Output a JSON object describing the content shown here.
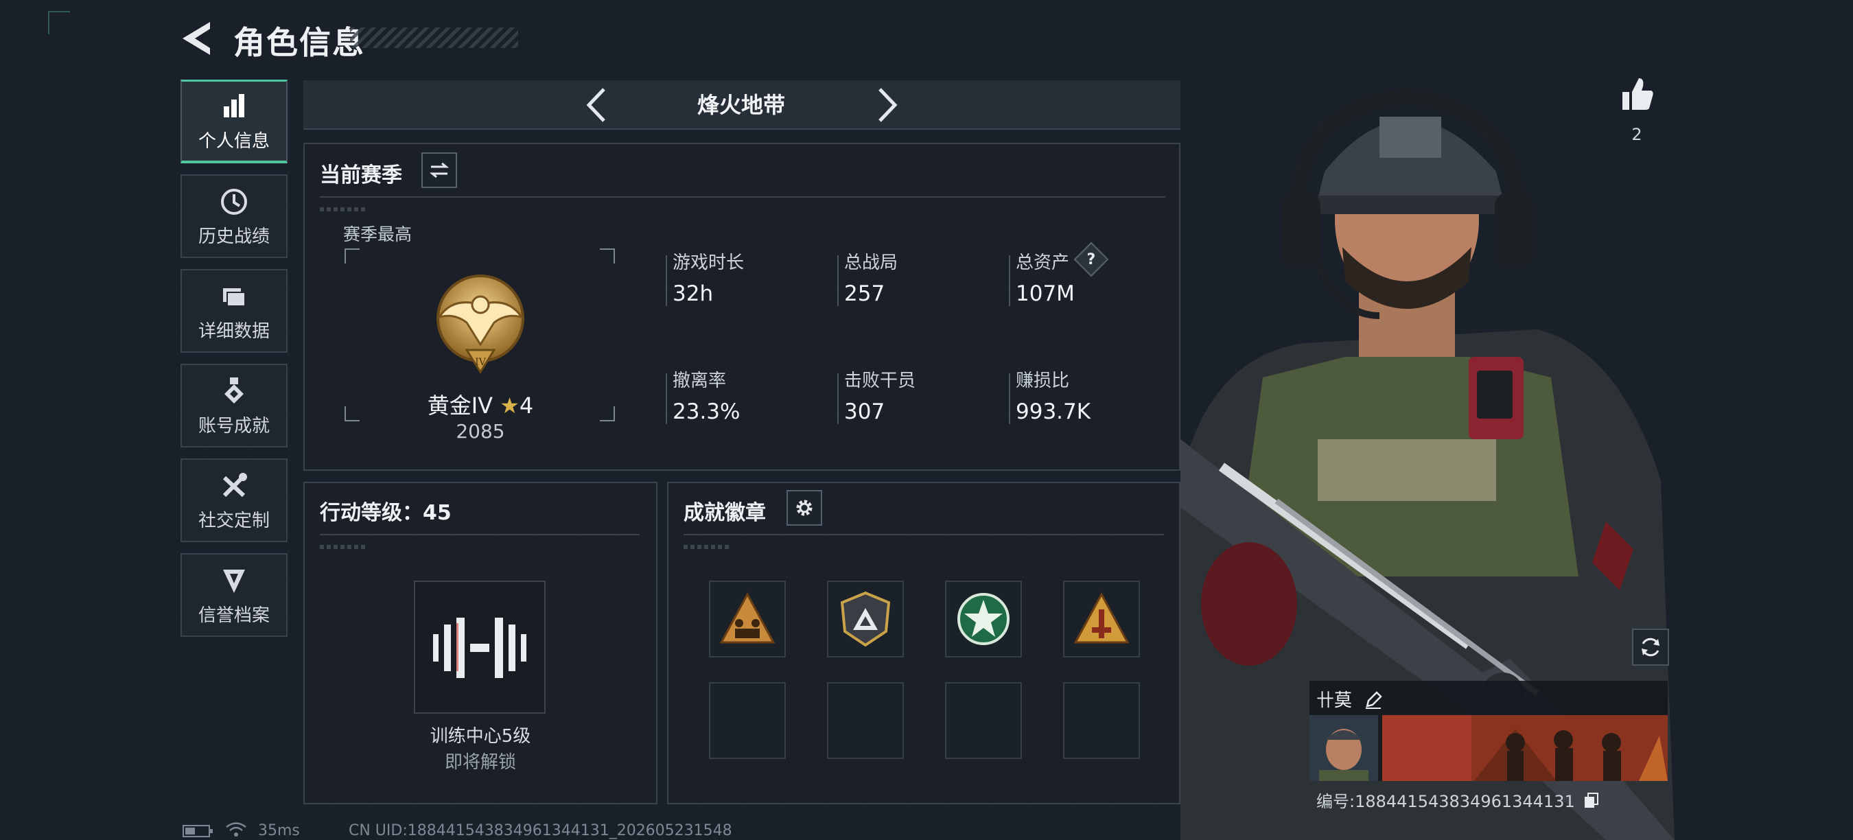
{
  "header": {
    "title": "角色信息"
  },
  "sidebar": {
    "items": [
      {
        "label": "个人信息",
        "icon": "bar-chart-icon",
        "active": true
      },
      {
        "label": "历史战绩",
        "icon": "history-icon"
      },
      {
        "label": "详细数据",
        "icon": "folder-icon"
      },
      {
        "label": "账号成就",
        "icon": "medal-icon"
      },
      {
        "label": "社交定制",
        "icon": "tools-icon"
      },
      {
        "label": "信誉档案",
        "icon": "reputation-icon"
      }
    ]
  },
  "mode": {
    "title": "烽火地带"
  },
  "season": {
    "title": "当前赛季",
    "best_label": "赛季最高",
    "rank_name": "黄金IV",
    "rank_stars": "4",
    "rank_score": "2085",
    "stats": [
      {
        "label": "游戏时长",
        "value": "32h"
      },
      {
        "label": "总战局",
        "value": "257"
      },
      {
        "label": "总资产",
        "value": "107M",
        "help": "?"
      },
      {
        "label": "撤离率",
        "value": "23.3%"
      },
      {
        "label": "击败干员",
        "value": "307"
      },
      {
        "label": "赚损比",
        "value": "993.7K"
      }
    ]
  },
  "action_level": {
    "title": "行动等级：45",
    "unlock_name": "训练中心5级",
    "unlock_status": "即将解锁"
  },
  "achievements": {
    "title": "成就徽章",
    "badges": [
      "triangle-soldiers-badge",
      "shield-triangle-badge",
      "green-star-badge",
      "triangle-tower-badge",
      "",
      "",
      "",
      ""
    ]
  },
  "character": {
    "likes": "2",
    "name": "卄莫",
    "uid_line": "编号:188441543834961344131"
  },
  "status_bar": {
    "ping": "35ms",
    "uid": "CN UID:188441543834961344131_202605231548"
  },
  "colors": {
    "accent": "#4ec7a0",
    "gold": "#c9a24a"
  }
}
